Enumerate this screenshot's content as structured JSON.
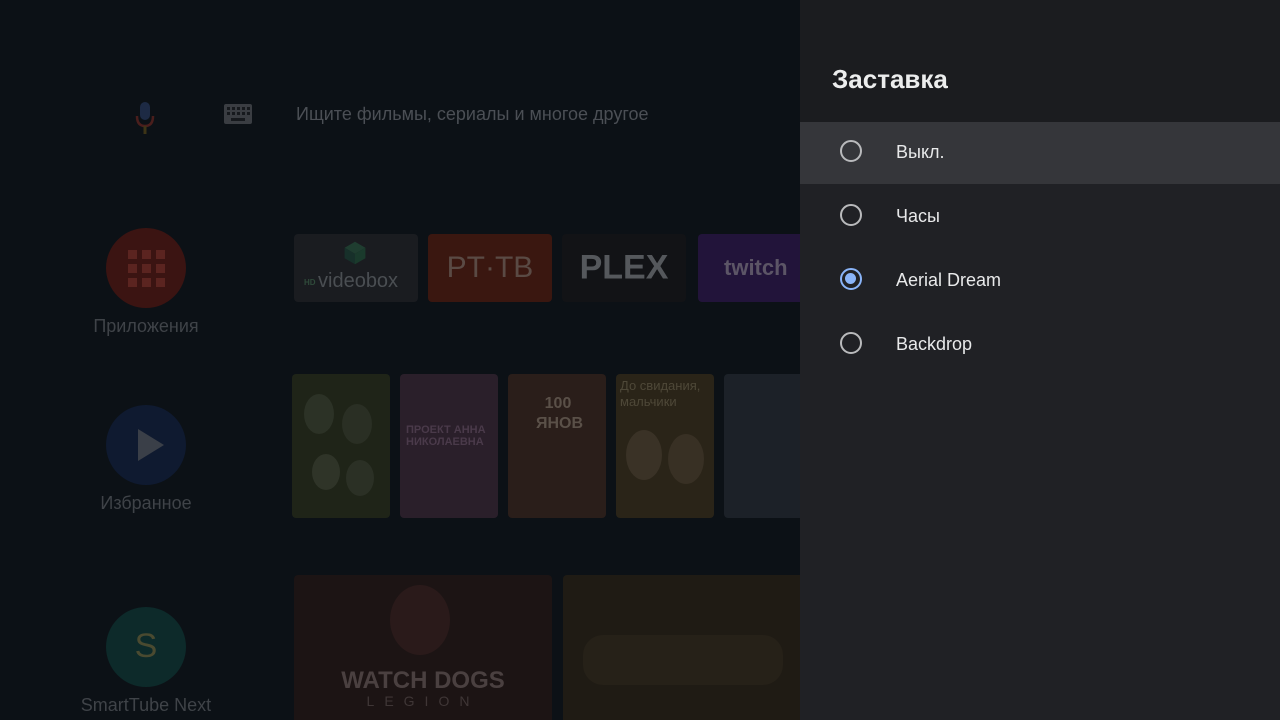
{
  "launcher": {
    "search_placeholder": "Ищите фильмы, сериалы и многое другое",
    "sidebar": [
      {
        "label": "Приложения",
        "icon": "apps-grid-icon",
        "color": "#3b1412"
      },
      {
        "label": "Избранное",
        "icon": "play-icon",
        "color": "#0f1a30"
      },
      {
        "label": "SmartTube Next",
        "icon": "smarttube-logo-icon",
        "letter": "S",
        "color": "#0d2a2a"
      }
    ],
    "apps": [
      {
        "name": "videobox",
        "badge": "HD",
        "color": "#1a1c20",
        "text_color": "#4a4e52"
      },
      {
        "name": "PT·TB",
        "color": "#3a1710",
        "text_color": "#5a4a44"
      },
      {
        "name": "PLEX",
        "color": "#121316",
        "text_color": "#55585c"
      },
      {
        "name": "twitch",
        "color": "#22143a",
        "text_color": "#5c5566"
      }
    ],
    "posters": [
      {
        "title": "",
        "color": "#1f2418"
      },
      {
        "title": "ПРОЕКТ АННА НИКОЛАЕВНА",
        "color": "#2a1f2a"
      },
      {
        "title": "100 ЯНОВ",
        "color": "#2a1e1a"
      },
      {
        "title": "До свидания, мальчики",
        "color": "#2a2418"
      },
      {
        "title": "",
        "color": "#1c2128"
      }
    ],
    "banners": [
      {
        "title": "WATCH DOGS",
        "subtitle": "LEGION",
        "color": "#1c1414"
      },
      {
        "title": "",
        "color": "#1f1b14"
      }
    ]
  },
  "panel": {
    "title": "Заставка",
    "options": [
      {
        "label": "Выкл.",
        "selected": false,
        "focused": true
      },
      {
        "label": "Часы",
        "selected": false,
        "focused": false
      },
      {
        "label": "Aerial Dream",
        "selected": true,
        "focused": false
      },
      {
        "label": "Backdrop",
        "selected": false,
        "focused": false
      }
    ]
  }
}
